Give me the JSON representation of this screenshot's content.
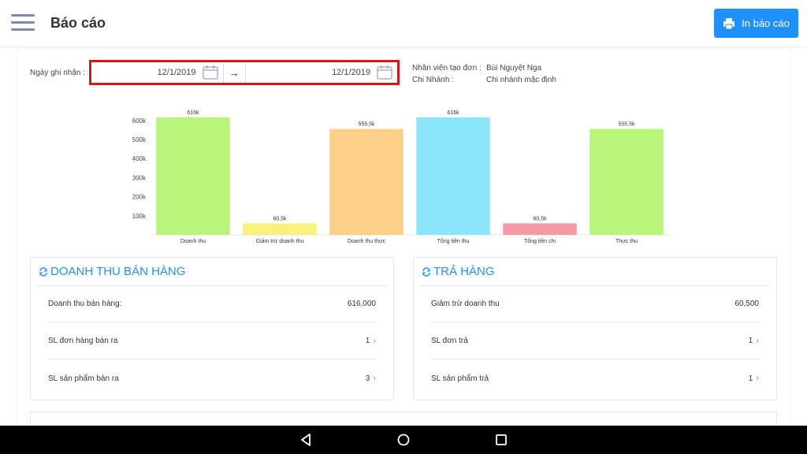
{
  "header": {
    "title": "Báo cáo",
    "print_label": "In báo cáo"
  },
  "filter": {
    "date_label": "Ngày ghi nhận :",
    "from_date": "12/1/2019",
    "to_date": "12/1/2019",
    "arrow": "→"
  },
  "info": {
    "creator_label": "Nhân viên tạo đơn :",
    "creator_value": "Bùi Nguyệt Nga",
    "branch_label": "Chi Nhánh :",
    "branch_value": "Chi nhánh mặc định"
  },
  "chart_data": {
    "type": "bar",
    "categories": [
      "Doanh thu",
      "Giảm trừ doanh thu",
      "Doanh thu thực",
      "Tổng tiền thu",
      "Tổng tiền chi",
      "Thực thu"
    ],
    "values": [
      616000,
      60500,
      555500,
      616000,
      60500,
      555500
    ],
    "data_labels": [
      "616k",
      "60,5k",
      "555,5k",
      "616k",
      "60,5k",
      "555,5k"
    ],
    "colors": [
      "#b8f57a",
      "#f9f07e",
      "#fdd08a",
      "#8be6fb",
      "#f59aa3",
      "#b8f57a"
    ],
    "y_ticks": [
      "100k",
      "200k",
      "300k",
      "400k",
      "500k",
      "600k"
    ],
    "y_tick_values": [
      100000,
      200000,
      300000,
      400000,
      500000,
      600000
    ],
    "ylim": [
      0,
      620000
    ],
    "title": "",
    "xlabel": "",
    "ylabel": ""
  },
  "sales": {
    "title": "Doanh thu bán hàng",
    "rows": [
      {
        "label": "Doanh thu bán hàng:",
        "value": "616,000"
      },
      {
        "label": "SL đơn hàng bán ra",
        "value": "1"
      },
      {
        "label": "SL sản phẩm bán ra",
        "value": "3"
      }
    ]
  },
  "returns": {
    "title": "Trả hàng",
    "rows": [
      {
        "label": "Giảm trừ doanh thu",
        "value": "60,500"
      },
      {
        "label": "SL đơn trả",
        "value": "1"
      },
      {
        "label": "SL sản phẩm trả",
        "value": "1"
      }
    ]
  },
  "chevron": "›",
  "colors": {
    "accent": "#1e90ff",
    "highlight": "#e0141e"
  },
  "icons": {
    "menu": "hamburger-icon",
    "print": "printer-icon",
    "calendar": "calendar-icon",
    "section": "refresh-icon",
    "back": "back-triangle-icon",
    "home": "home-circle-icon",
    "recents": "recents-square-icon"
  }
}
